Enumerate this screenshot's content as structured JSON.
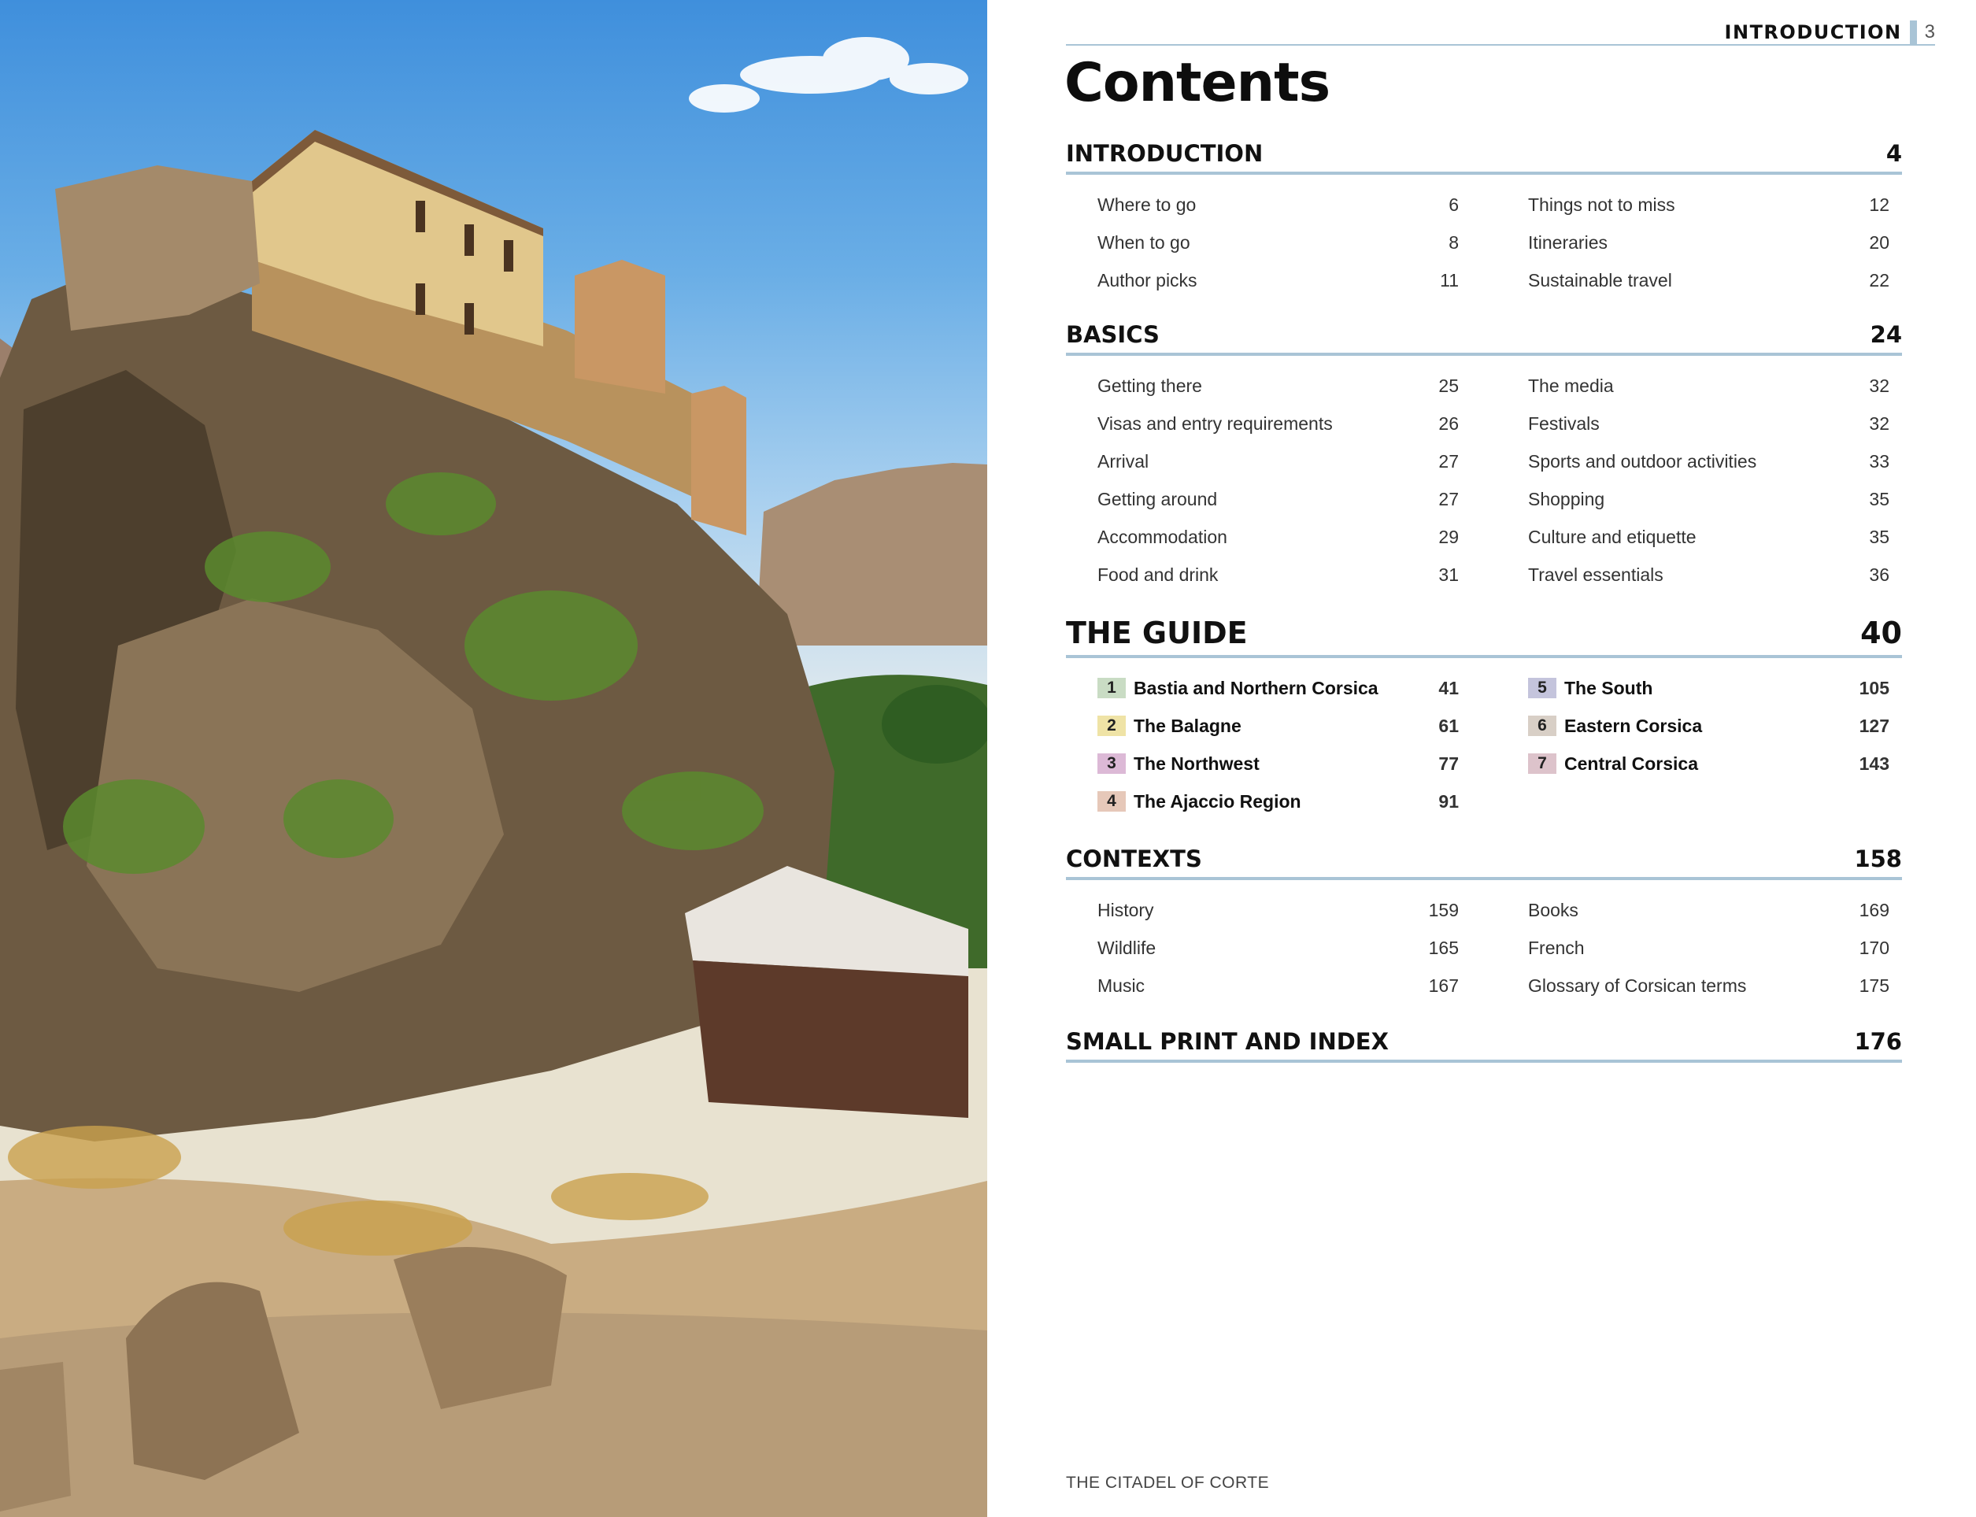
{
  "photo": {
    "description_icon": "citadel-photo"
  },
  "header": {
    "running_title": "INTRODUCTION",
    "page_number": "3"
  },
  "title": "Contents",
  "sections": {
    "introduction": {
      "title": "INTRODUCTION",
      "page": "4",
      "left": [
        {
          "label": "Where to go",
          "page": "6"
        },
        {
          "label": "When to go",
          "page": "8"
        },
        {
          "label": "Author picks",
          "page": "11"
        }
      ],
      "right": [
        {
          "label": "Things not to miss",
          "page": "12"
        },
        {
          "label": "Itineraries",
          "page": "20"
        },
        {
          "label": "Sustainable travel",
          "page": "22"
        }
      ]
    },
    "basics": {
      "title": "BASICS",
      "page": "24",
      "left": [
        {
          "label": "Getting there",
          "page": "25"
        },
        {
          "label": "Visas and entry requirements",
          "page": "26"
        },
        {
          "label": "Arrival",
          "page": "27"
        },
        {
          "label": "Getting around",
          "page": "27"
        },
        {
          "label": "Accommodation",
          "page": "29"
        },
        {
          "label": "Food and drink",
          "page": "31"
        }
      ],
      "right": [
        {
          "label": "The media",
          "page": "32"
        },
        {
          "label": "Festivals",
          "page": "32"
        },
        {
          "label": "Sports and outdoor activities",
          "page": "33"
        },
        {
          "label": "Shopping",
          "page": "35"
        },
        {
          "label": "Culture and etiquette",
          "page": "35"
        },
        {
          "label": "Travel essentials",
          "page": "36"
        }
      ]
    },
    "guide": {
      "title": "THE GUIDE",
      "page": "40",
      "left": [
        {
          "num": "1",
          "label": "Bastia and Northern Corsica",
          "page": "41",
          "color": "#c9dcc4"
        },
        {
          "num": "2",
          "label": "The Balagne",
          "page": "61",
          "color": "#efe3a6"
        },
        {
          "num": "3",
          "label": "The Northwest",
          "page": "77",
          "color": "#dcb9d6"
        },
        {
          "num": "4",
          "label": "The Ajaccio Region",
          "page": "91",
          "color": "#e6c8b9"
        }
      ],
      "right": [
        {
          "num": "5",
          "label": "The South",
          "page": "105",
          "color": "#c4c4dc"
        },
        {
          "num": "6",
          "label": "Eastern Corsica",
          "page": "127",
          "color": "#d8cfc6"
        },
        {
          "num": "7",
          "label": "Central Corsica",
          "page": "143",
          "color": "#ddc3cb"
        }
      ]
    },
    "contexts": {
      "title": "CONTEXTS",
      "page": "158",
      "left": [
        {
          "label": "History",
          "page": "159"
        },
        {
          "label": "Wildlife",
          "page": "165"
        },
        {
          "label": "Music",
          "page": "167"
        }
      ],
      "right": [
        {
          "label": "Books",
          "page": "169"
        },
        {
          "label": "French",
          "page": "170"
        },
        {
          "label": "Glossary of Corsican terms",
          "page": "175"
        }
      ]
    },
    "small_print": {
      "title": "SMALL PRINT AND INDEX",
      "page": "176"
    }
  },
  "caption": "THE CITADEL OF CORTE",
  "colors": {
    "rule": "#a9c4d6"
  }
}
